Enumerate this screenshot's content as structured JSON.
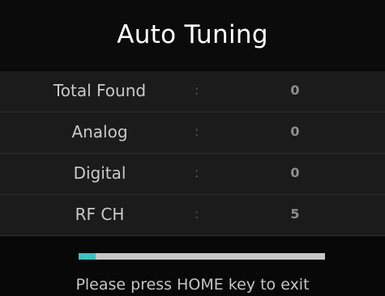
{
  "dialog": {
    "title": "Auto Tuning"
  },
  "rows": [
    {
      "label": "Total Found",
      "separator": ":",
      "value": "0"
    },
    {
      "label": "Analog",
      "separator": ":",
      "value": "0"
    },
    {
      "label": "Digital",
      "separator": ":",
      "value": "0"
    },
    {
      "label": "RF CH",
      "separator": ":",
      "value": "5"
    }
  ],
  "progress": {
    "fraction": 0.07,
    "fill_color": "#3fc1c1",
    "track_color": "#c7c7c7"
  },
  "hint": {
    "text": "Please press HOME key to exit"
  }
}
